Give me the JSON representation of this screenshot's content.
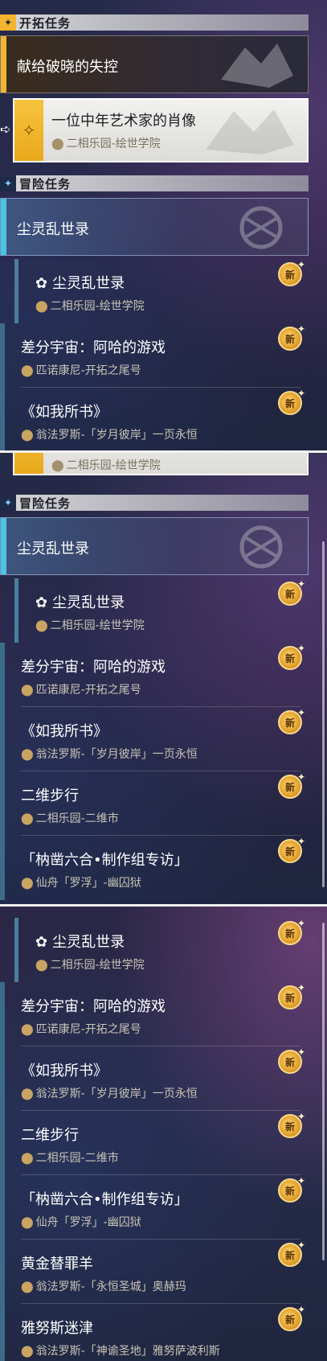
{
  "sections": {
    "trailblaze": "开拓任务",
    "adventure": "冒险任务"
  },
  "trail_missions": {
    "pinned_title": "献给破晓的失控",
    "selected_title": "一位中年艺术家的肖像",
    "selected_location": "二相乐园-绘世学院"
  },
  "adventure": {
    "current_title": "尘灵乱世录",
    "new_badge": "新",
    "items": [
      {
        "title": "尘灵乱世录",
        "location": "二相乐园-绘世学院"
      },
      {
        "title": "差分宇宙：阿哈的游戏",
        "location": "匹诺康尼-开拓之尾号"
      },
      {
        "title": "《如我所书》",
        "location": "翁法罗斯-「岁月彼岸」一页永恒"
      },
      {
        "title": "二维步行",
        "location": "二相乐园-二维市"
      },
      {
        "title": "「枘凿六合•制作组专访」",
        "location": "仙舟「罗浮」-幽囚狱"
      },
      {
        "title": "黄金替罪羊",
        "location": "翁法罗斯-「永恒圣城」奥赫玛"
      },
      {
        "title": "雅努斯迷津",
        "location": "翁法罗斯-「神谕圣地」雅努萨波利斯"
      }
    ]
  },
  "icons": {
    "pin": "location-pin-icon",
    "new": "new-badge-icon",
    "sub_item": "dust-spirit-icon"
  },
  "colors": {
    "trail_accent": "#f2b431",
    "adventure_accent": "#49c5e6",
    "new_badge": "#e2a02c"
  }
}
